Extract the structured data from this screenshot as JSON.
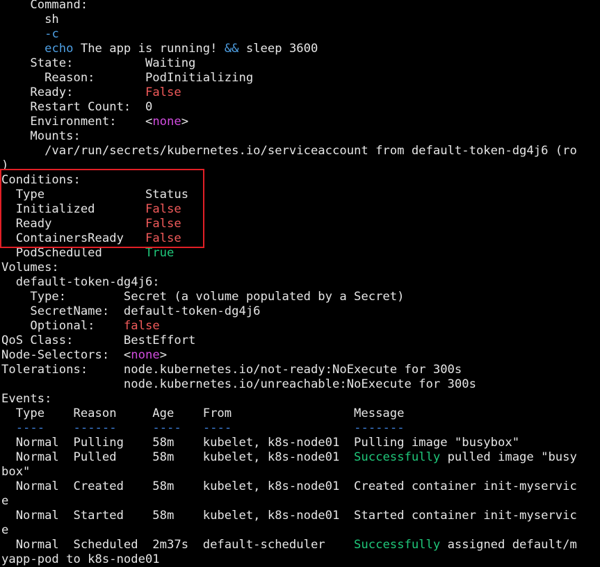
{
  "colors": {
    "background": "#000000",
    "text": "#e6e6e6",
    "false_value": "#f05a5a",
    "true_value": "#1fc77a",
    "keyword": "#4e9fe3",
    "none_value": "#d24de0",
    "highlight_border": "#e21f26"
  },
  "lines": [
    {
      "segments": [
        {
          "t": "    Command:",
          "c": ""
        }
      ]
    },
    {
      "segments": [
        {
          "t": "      sh",
          "c": ""
        }
      ]
    },
    {
      "segments": [
        {
          "t": "      ",
          "c": ""
        },
        {
          "t": "-c",
          "c": "blue"
        }
      ]
    },
    {
      "segments": [
        {
          "t": "      ",
          "c": ""
        },
        {
          "t": "echo",
          "c": "blue"
        },
        {
          "t": " The app is running! ",
          "c": ""
        },
        {
          "t": "&&",
          "c": "blue"
        },
        {
          "t": " sleep 3600",
          "c": ""
        }
      ]
    },
    {
      "segments": [
        {
          "t": "    State:          Waiting",
          "c": ""
        }
      ]
    },
    {
      "segments": [
        {
          "t": "      Reason:       PodInitializing",
          "c": ""
        }
      ]
    },
    {
      "segments": [
        {
          "t": "    Ready:          ",
          "c": ""
        },
        {
          "t": "False",
          "c": "red"
        }
      ]
    },
    {
      "segments": [
        {
          "t": "    Restart Count:  0",
          "c": ""
        }
      ]
    },
    {
      "segments": [
        {
          "t": "    Environment:    ",
          "c": ""
        },
        {
          "t": "<",
          "c": ""
        },
        {
          "t": "none",
          "c": "magenta"
        },
        {
          "t": ">",
          "c": ""
        }
      ]
    },
    {
      "segments": [
        {
          "t": "    Mounts:",
          "c": ""
        }
      ]
    },
    {
      "segments": [
        {
          "t": "      /var/run/secrets/kubernetes.io/serviceaccount from default-token-dg4j6 (ro",
          "c": ""
        }
      ]
    },
    {
      "segments": [
        {
          "t": ")",
          "c": ""
        }
      ]
    },
    {
      "segments": [
        {
          "t": "Conditions:",
          "c": ""
        }
      ]
    },
    {
      "segments": [
        {
          "t": "  Type              Status",
          "c": ""
        }
      ]
    },
    {
      "segments": [
        {
          "t": "  Initialized       ",
          "c": ""
        },
        {
          "t": "False",
          "c": "red"
        }
      ]
    },
    {
      "segments": [
        {
          "t": "  Ready             ",
          "c": ""
        },
        {
          "t": "False",
          "c": "red"
        }
      ]
    },
    {
      "segments": [
        {
          "t": "  ContainersReady   ",
          "c": ""
        },
        {
          "t": "False",
          "c": "red"
        }
      ]
    },
    {
      "segments": [
        {
          "t": "  PodScheduled      ",
          "c": ""
        },
        {
          "t": "True",
          "c": "green"
        }
      ]
    },
    {
      "segments": [
        {
          "t": "Volumes:",
          "c": ""
        }
      ]
    },
    {
      "segments": [
        {
          "t": "  default-token-dg4j6:",
          "c": ""
        }
      ]
    },
    {
      "segments": [
        {
          "t": "    Type:        Secret (a volume populated by a Secret)",
          "c": ""
        }
      ]
    },
    {
      "segments": [
        {
          "t": "    SecretName:  default-token-dg4j6",
          "c": ""
        }
      ]
    },
    {
      "segments": [
        {
          "t": "    Optional:    ",
          "c": ""
        },
        {
          "t": "false",
          "c": "red"
        }
      ]
    },
    {
      "segments": [
        {
          "t": "QoS Class:       BestEffort",
          "c": ""
        }
      ]
    },
    {
      "segments": [
        {
          "t": "Node-Selectors:  ",
          "c": ""
        },
        {
          "t": "<",
          "c": ""
        },
        {
          "t": "none",
          "c": "magenta"
        },
        {
          "t": ">",
          "c": ""
        }
      ]
    },
    {
      "segments": [
        {
          "t": "Tolerations:     node.kubernetes.io/not-ready:NoExecute for 300s",
          "c": ""
        }
      ]
    },
    {
      "segments": [
        {
          "t": "                 node.kubernetes.io/unreachable:NoExecute for 300s",
          "c": ""
        }
      ]
    },
    {
      "segments": [
        {
          "t": "Events:",
          "c": ""
        }
      ]
    },
    {
      "segments": [
        {
          "t": "  Type    Reason     Age    From                 Message",
          "c": ""
        }
      ]
    },
    {
      "segments": [
        {
          "t": "  ",
          "c": ""
        },
        {
          "t": "----",
          "c": "dash"
        },
        {
          "t": "    ",
          "c": ""
        },
        {
          "t": "------",
          "c": "dash"
        },
        {
          "t": "     ",
          "c": ""
        },
        {
          "t": "----",
          "c": "dash"
        },
        {
          "t": "   ",
          "c": ""
        },
        {
          "t": "----",
          "c": "dash"
        },
        {
          "t": "                 ",
          "c": ""
        },
        {
          "t": "-------",
          "c": "dash"
        }
      ]
    },
    {
      "segments": [
        {
          "t": "  Normal  Pulling    58m    kubelet, k8s-node01  Pulling image \"busybox\"",
          "c": ""
        }
      ]
    },
    {
      "segments": [
        {
          "t": "  Normal  Pulled     58m    kubelet, k8s-node01  ",
          "c": ""
        },
        {
          "t": "Successfully",
          "c": "green"
        },
        {
          "t": " pulled image \"busy",
          "c": ""
        }
      ]
    },
    {
      "segments": [
        {
          "t": "box\"",
          "c": ""
        }
      ]
    },
    {
      "segments": [
        {
          "t": "  Normal  Created    58m    kubelet, k8s-node01  Created container init-myservic",
          "c": ""
        }
      ]
    },
    {
      "segments": [
        {
          "t": "e",
          "c": ""
        }
      ]
    },
    {
      "segments": [
        {
          "t": "  Normal  Started    58m    kubelet, k8s-node01  Started container init-myservic",
          "c": ""
        }
      ]
    },
    {
      "segments": [
        {
          "t": "e",
          "c": ""
        }
      ]
    },
    {
      "segments": [
        {
          "t": "  Normal  Scheduled  2m37s  default-scheduler    ",
          "c": ""
        },
        {
          "t": "Successfully",
          "c": "green"
        },
        {
          "t": " assigned default/m",
          "c": ""
        }
      ]
    },
    {
      "segments": [
        {
          "t": "yapp-pod to k8s-node01",
          "c": ""
        }
      ]
    }
  ]
}
